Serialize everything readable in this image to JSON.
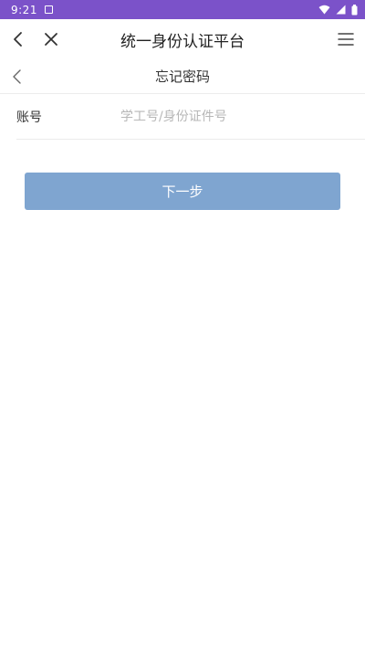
{
  "status_bar": {
    "time": "9:21"
  },
  "app_header": {
    "title": "统一身份认证平台"
  },
  "page": {
    "title": "忘记密码"
  },
  "form": {
    "account_label": "账号",
    "account_placeholder": "学工号/身份证件号",
    "account_value": ""
  },
  "actions": {
    "next_label": "下一步"
  },
  "colors": {
    "status_bar": "#7b52c9",
    "button": "#7fa5d0",
    "divider": "#ececec",
    "placeholder": "#b7b7b7"
  }
}
